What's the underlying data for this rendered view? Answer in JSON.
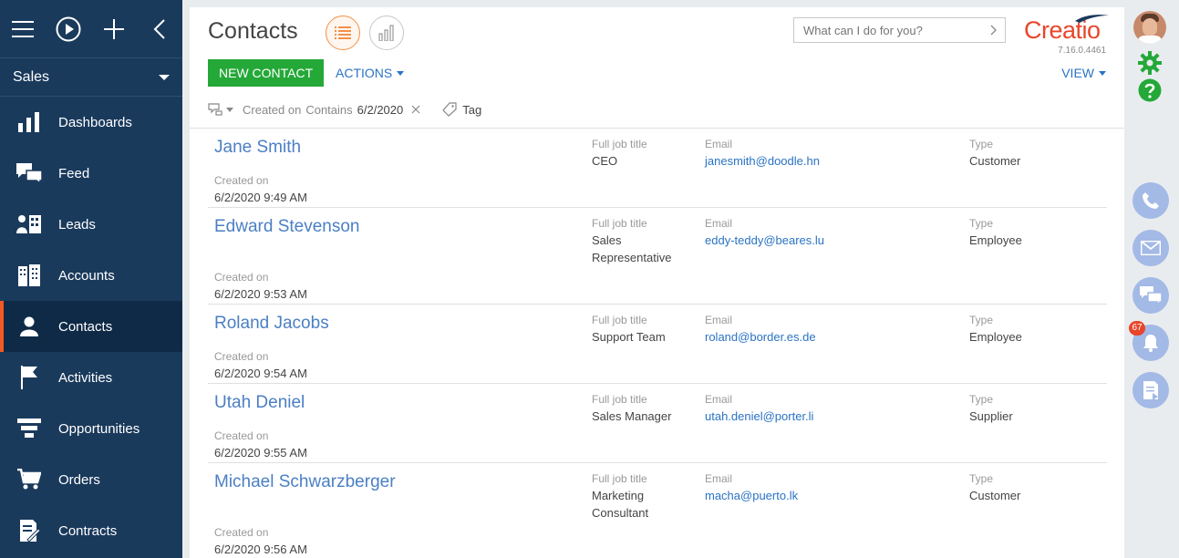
{
  "workspace": "Sales",
  "nav": [
    {
      "label": "Dashboards",
      "icon": "bar-chart-icon"
    },
    {
      "label": "Feed",
      "icon": "feed-icon"
    },
    {
      "label": "Leads",
      "icon": "leads-icon"
    },
    {
      "label": "Accounts",
      "icon": "building-icon"
    },
    {
      "label": "Contacts",
      "icon": "person-icon",
      "active": true
    },
    {
      "label": "Activities",
      "icon": "flag-icon"
    },
    {
      "label": "Opportunities",
      "icon": "funnel-icon"
    },
    {
      "label": "Orders",
      "icon": "cart-icon"
    },
    {
      "label": "Contracts",
      "icon": "contract-icon"
    }
  ],
  "header": {
    "title": "Contacts",
    "search_placeholder": "What can I do for you?",
    "logo": "Creatio",
    "version": "7.16.0.4461"
  },
  "toolbar": {
    "new_label": "NEW CONTACT",
    "actions_label": "ACTIONS",
    "view_label": "VIEW"
  },
  "filter": {
    "field": "Created on",
    "condition": "Contains",
    "value": "6/2/2020",
    "tag_label": "Tag"
  },
  "labels": {
    "job": "Full job title",
    "email": "Email",
    "type": "Type",
    "created": "Created on"
  },
  "contacts": [
    {
      "name": "Jane Smith",
      "job1": "CEO",
      "job2": "",
      "email": "janesmith@doodle.hn",
      "type": "Customer",
      "created": "6/2/2020 9:49 AM"
    },
    {
      "name": "Edward Stevenson",
      "job1": "Sales",
      "job2": "Representative",
      "email": "eddy-teddy@beares.lu",
      "type": "Employee",
      "created": "6/2/2020 9:53 AM"
    },
    {
      "name": "Roland Jacobs",
      "job1": "Support Team",
      "job2": "",
      "email": "roland@border.es.de",
      "type": "Employee",
      "created": "6/2/2020 9:54 AM"
    },
    {
      "name": "Utah Deniel",
      "job1": "Sales Manager",
      "job2": "",
      "email": "utah.deniel@porter.li",
      "type": "Supplier",
      "created": "6/2/2020 9:55 AM"
    },
    {
      "name": "Michael Schwarzberger",
      "job1": "Marketing",
      "job2": "Consultant",
      "email": "macha@puerto.lk",
      "type": "Customer",
      "created": "6/2/2020 9:56 AM"
    }
  ],
  "notifications_count": "67",
  "colors": {
    "sidebar": "#1a3a5c",
    "accent": "#f15a22",
    "primary_button": "#24a838",
    "link": "#2a73c4"
  }
}
